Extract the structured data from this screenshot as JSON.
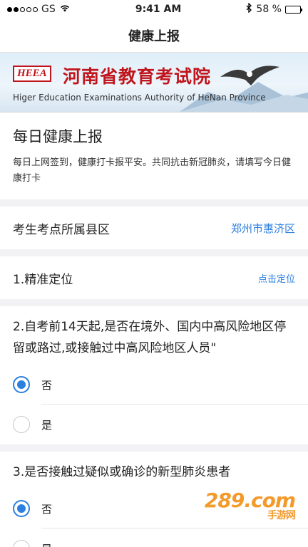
{
  "status_bar": {
    "carrier": "GS",
    "time": "9:41 AM",
    "battery": "58 %",
    "battery_level": 0.58
  },
  "nav": {
    "title": "健康上报"
  },
  "banner": {
    "logo": "HEEA",
    "title_cn": "河南省教育考试院",
    "title_en": "Higer Education Examinations Authority of HeNan Province"
  },
  "report": {
    "title": "每日健康上报",
    "desc": "每日上网签到，健康打卡报平安。共同抗击新冠肺炎，请填写今日健康打卡"
  },
  "county_row": {
    "label": "考生考点所属县区",
    "value": "郑州市惠济区"
  },
  "location_row": {
    "label": "1.精准定位",
    "action": "点击定位"
  },
  "questions": [
    {
      "text": "2.自考前14天起,是否在境外、国内中高风险地区停留或路过,或接触过中高风险地区人员\"",
      "options": [
        {
          "label": "否",
          "checked": true
        },
        {
          "label": "是",
          "checked": false
        }
      ]
    },
    {
      "text": "3.是否接触过疑似或确诊的新型肺炎患者",
      "options": [
        {
          "label": "否",
          "checked": true
        },
        {
          "label": "是",
          "checked": false
        }
      ]
    }
  ],
  "watermark": {
    "main": "289.com",
    "sub": "手游网"
  },
  "colors": {
    "accent": "#2b7fe0",
    "brand_red": "#c0151c",
    "watermark": "#f39a2b"
  }
}
